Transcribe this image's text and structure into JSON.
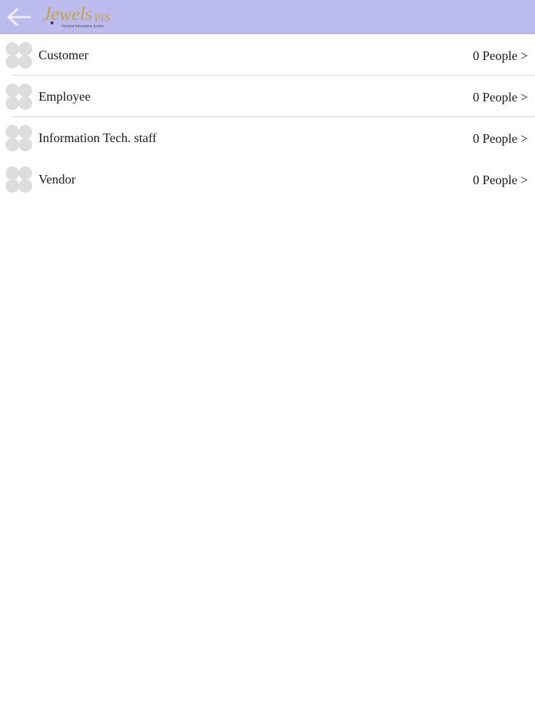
{
  "header": {
    "back_icon": "back-arrow-icon",
    "logo_text": "Jewels",
    "logo_suffix": "PIS",
    "logo_tagline": "Personal Information System",
    "background": "#bbbbed",
    "logo_color": "#c9a14a"
  },
  "groups": [
    {
      "label": "Customer",
      "count": "0 People >"
    },
    {
      "label": "Employee",
      "count": "0 People >"
    },
    {
      "label": "Information Tech. staff",
      "count": "0 People >"
    },
    {
      "label": "Vendor",
      "count": "0 People >"
    }
  ]
}
